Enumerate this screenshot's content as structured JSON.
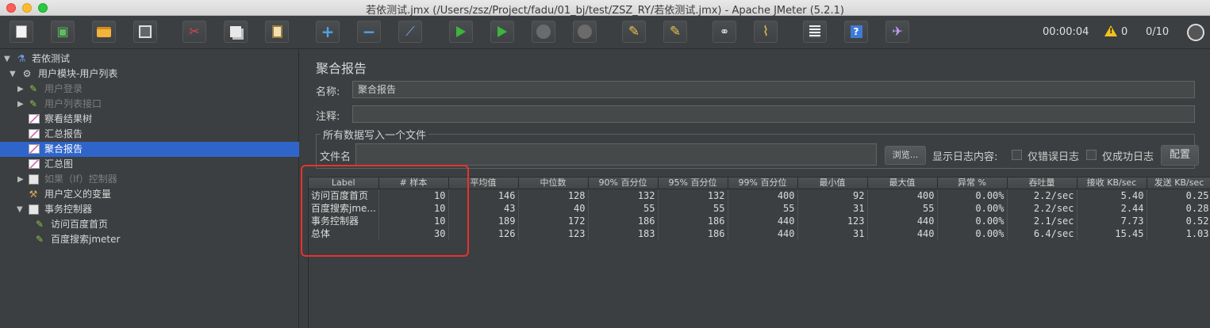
{
  "window": {
    "title": "若依测试.jmx (/Users/zsz/Project/fadu/01_bj/test/ZSZ_RY/若依测试.jmx) - Apache JMeter (5.2.1)"
  },
  "toolbar": {
    "elapsed_time": "00:00:04",
    "warning_count": "0",
    "threads": "0/10",
    "icons": [
      "new-file-icon",
      "templates-icon",
      "open-icon",
      "save-icon",
      "cut-icon",
      "copy-icon",
      "paste-icon",
      "expand-icon",
      "collapse-icon",
      "toggle-icon",
      "start-icon",
      "start-no-pauses-icon",
      "stop-icon",
      "shutdown-icon",
      "clear-icon",
      "clear-all-icon",
      "search-icon",
      "reset-search-icon",
      "function-helper-icon",
      "help-icon",
      "remote-icon"
    ]
  },
  "tree": {
    "nodes": [
      {
        "label": "若依测试",
        "icon": "test-plan-icon",
        "expanded": true
      },
      {
        "label": "用户模块-用户列表",
        "icon": "thread-group-icon",
        "expanded": true
      },
      {
        "label": "用户登录",
        "icon": "sampler-icon",
        "disabled": true
      },
      {
        "label": "用户列表接口",
        "icon": "sampler-icon",
        "disabled": true
      },
      {
        "label": "察看结果树",
        "icon": "listener-icon"
      },
      {
        "label": "汇总报告",
        "icon": "listener-icon"
      },
      {
        "label": "聚合报告",
        "icon": "listener-icon",
        "selected": true
      },
      {
        "label": "汇总图",
        "icon": "listener-icon"
      },
      {
        "label": "如果（If）控制器",
        "icon": "controller-icon",
        "disabled": true
      },
      {
        "label": "用户定义的变量",
        "icon": "config-icon"
      },
      {
        "label": "事务控制器",
        "icon": "controller-icon",
        "expanded": true
      },
      {
        "label": "访问百度首页",
        "icon": "sampler-icon"
      },
      {
        "label": "百度搜索jmeter",
        "icon": "sampler-icon"
      }
    ]
  },
  "panel": {
    "title": "聚合报告",
    "name_label": "名称:",
    "name_value": "聚合报告",
    "comment_label": "注释:",
    "comment_value": "",
    "file_group_legend": "所有数据写入一个文件",
    "filename_label": "文件名",
    "filename_value": "",
    "browse_button": "浏览...",
    "log_content_label": "显示日志内容:",
    "errors_only_label": "仅错误日志",
    "success_only_label": "仅成功日志",
    "configure_button": "配置"
  },
  "table": {
    "headers": [
      "Label",
      "# 样本",
      "平均值",
      "中位数",
      "90% 百分位",
      "95% 百分位",
      "99% 百分位",
      "最小值",
      "最大值",
      "异常 %",
      "吞吐量",
      "接收 KB/sec",
      "发送 KB/sec"
    ],
    "rows": [
      [
        "访问百度首页",
        "10",
        "146",
        "128",
        "132",
        "132",
        "400",
        "92",
        "400",
        "0.00%",
        "2.2/sec",
        "5.40",
        "0.25"
      ],
      [
        "百度搜索jme...",
        "10",
        "43",
        "40",
        "55",
        "55",
        "55",
        "31",
        "55",
        "0.00%",
        "2.2/sec",
        "2.44",
        "0.28"
      ],
      [
        "事务控制器",
        "10",
        "189",
        "172",
        "186",
        "186",
        "440",
        "123",
        "440",
        "0.00%",
        "2.1/sec",
        "7.73",
        "0.52"
      ],
      [
        "总体",
        "30",
        "126",
        "123",
        "183",
        "186",
        "440",
        "31",
        "440",
        "0.00%",
        "6.4/sec",
        "15.45",
        "1.03"
      ]
    ]
  },
  "colors": {
    "selected": "#2f65ca",
    "annotation": "#e8322e",
    "background": "#3c3f41"
  }
}
